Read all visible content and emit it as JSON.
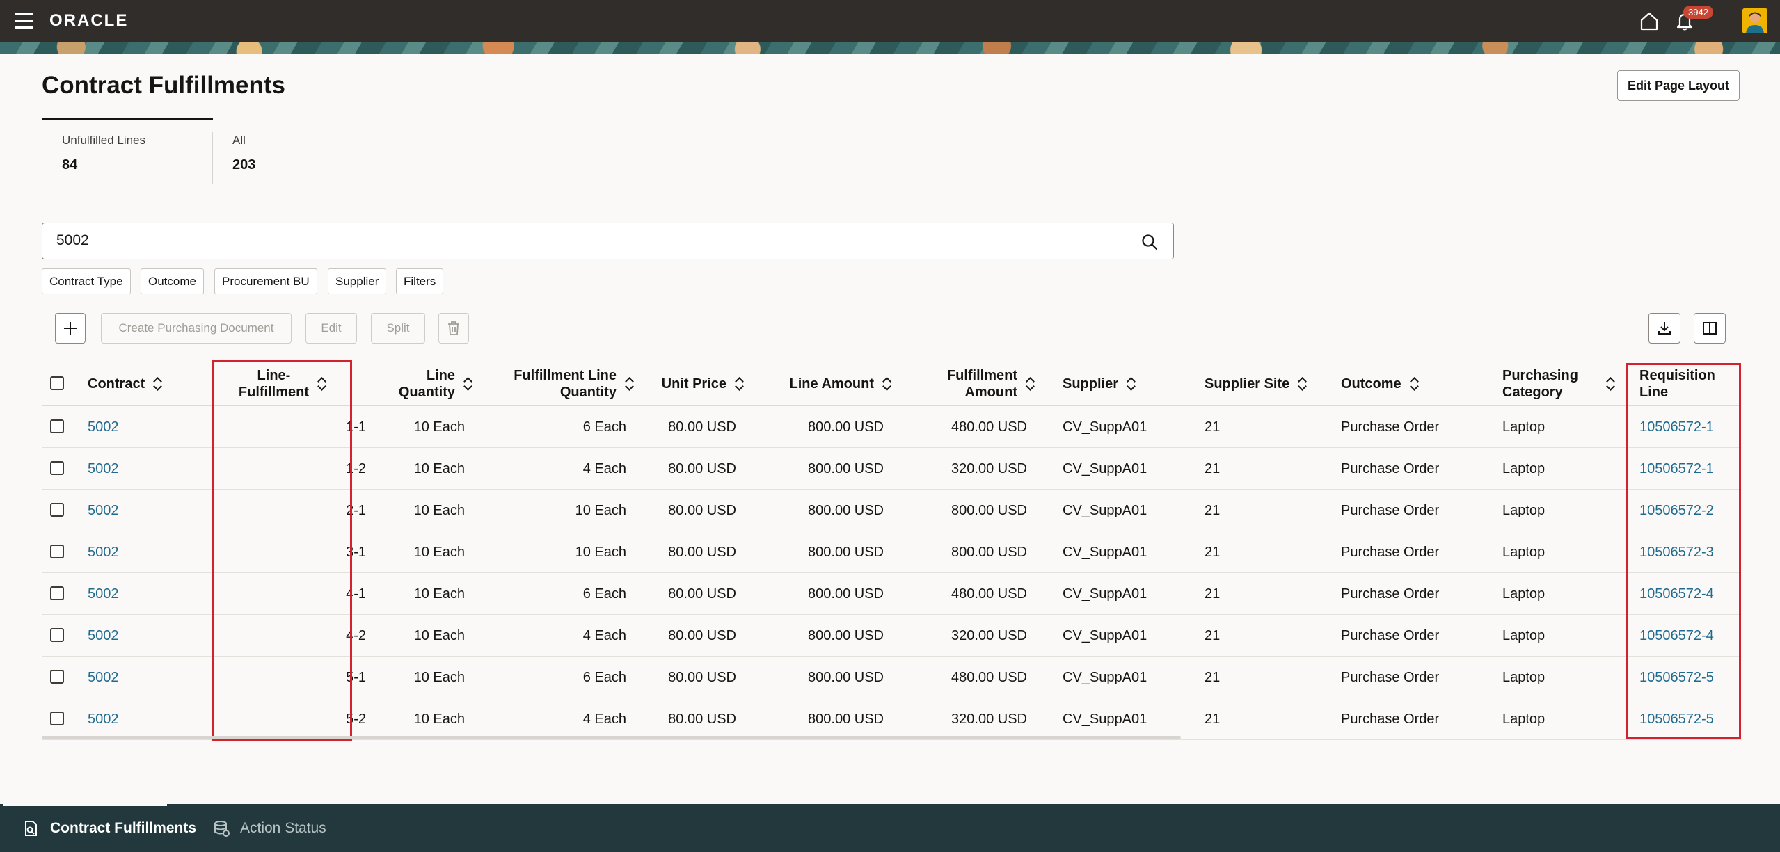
{
  "header": {
    "logo": "ORACLE",
    "notification_count": "3942"
  },
  "page": {
    "title": "Contract Fulfillments",
    "edit_layout_label": "Edit Page Layout"
  },
  "count_tabs": [
    {
      "label": "Unfulfilled Lines",
      "value": "84"
    },
    {
      "label": "All",
      "value": "203"
    }
  ],
  "search": {
    "value": "5002"
  },
  "filter_chips": [
    "Contract Type",
    "Outcome",
    "Procurement BU",
    "Supplier",
    "Filters"
  ],
  "toolbar": {
    "create_label": "Create Purchasing Document",
    "edit_label": "Edit",
    "split_label": "Split"
  },
  "table": {
    "headers": {
      "contract": "Contract",
      "line_fulfillment_1": "Line-",
      "line_fulfillment_2": "Fulfillment",
      "line_quantity_1": "Line",
      "line_quantity_2": "Quantity",
      "fulfillment_line_quantity_1": "Fulfillment Line",
      "fulfillment_line_quantity_2": "Quantity",
      "unit_price": "Unit Price",
      "line_amount": "Line Amount",
      "fulfillment_amount_1": "Fulfillment",
      "fulfillment_amount_2": "Amount",
      "supplier": "Supplier",
      "supplier_site": "Supplier Site",
      "outcome": "Outcome",
      "purchasing_category_1": "Purchasing",
      "purchasing_category_2": "Category",
      "requisition_line_1": "Requisition",
      "requisition_line_2": "Line"
    },
    "rows": [
      {
        "contract": "5002",
        "line_fulfillment": "1-1",
        "line_quantity": "10 Each",
        "fulfillment_line_quantity": "6 Each",
        "unit_price": "80.00 USD",
        "line_amount": "800.00 USD",
        "fulfillment_amount": "480.00 USD",
        "supplier": "CV_SuppA01",
        "supplier_site": "21",
        "outcome": "Purchase Order",
        "purchasing_category": "Laptop",
        "requisition_line": "10506572-1"
      },
      {
        "contract": "5002",
        "line_fulfillment": "1-2",
        "line_quantity": "10 Each",
        "fulfillment_line_quantity": "4 Each",
        "unit_price": "80.00 USD",
        "line_amount": "800.00 USD",
        "fulfillment_amount": "320.00 USD",
        "supplier": "CV_SuppA01",
        "supplier_site": "21",
        "outcome": "Purchase Order",
        "purchasing_category": "Laptop",
        "requisition_line": "10506572-1"
      },
      {
        "contract": "5002",
        "line_fulfillment": "2-1",
        "line_quantity": "10 Each",
        "fulfillment_line_quantity": "10 Each",
        "unit_price": "80.00 USD",
        "line_amount": "800.00 USD",
        "fulfillment_amount": "800.00 USD",
        "supplier": "CV_SuppA01",
        "supplier_site": "21",
        "outcome": "Purchase Order",
        "purchasing_category": "Laptop",
        "requisition_line": "10506572-2"
      },
      {
        "contract": "5002",
        "line_fulfillment": "3-1",
        "line_quantity": "10 Each",
        "fulfillment_line_quantity": "10 Each",
        "unit_price": "80.00 USD",
        "line_amount": "800.00 USD",
        "fulfillment_amount": "800.00 USD",
        "supplier": "CV_SuppA01",
        "supplier_site": "21",
        "outcome": "Purchase Order",
        "purchasing_category": "Laptop",
        "requisition_line": "10506572-3"
      },
      {
        "contract": "5002",
        "line_fulfillment": "4-1",
        "line_quantity": "10 Each",
        "fulfillment_line_quantity": "6 Each",
        "unit_price": "80.00 USD",
        "line_amount": "800.00 USD",
        "fulfillment_amount": "480.00 USD",
        "supplier": "CV_SuppA01",
        "supplier_site": "21",
        "outcome": "Purchase Order",
        "purchasing_category": "Laptop",
        "requisition_line": "10506572-4"
      },
      {
        "contract": "5002",
        "line_fulfillment": "4-2",
        "line_quantity": "10 Each",
        "fulfillment_line_quantity": "4 Each",
        "unit_price": "80.00 USD",
        "line_amount": "800.00 USD",
        "fulfillment_amount": "320.00 USD",
        "supplier": "CV_SuppA01",
        "supplier_site": "21",
        "outcome": "Purchase Order",
        "purchasing_category": "Laptop",
        "requisition_line": "10506572-4"
      },
      {
        "contract": "5002",
        "line_fulfillment": "5-1",
        "line_quantity": "10 Each",
        "fulfillment_line_quantity": "6 Each",
        "unit_price": "80.00 USD",
        "line_amount": "800.00 USD",
        "fulfillment_amount": "480.00 USD",
        "supplier": "CV_SuppA01",
        "supplier_site": "21",
        "outcome": "Purchase Order",
        "purchasing_category": "Laptop",
        "requisition_line": "10506572-5"
      },
      {
        "contract": "5002",
        "line_fulfillment": "5-2",
        "line_quantity": "10 Each",
        "fulfillment_line_quantity": "4 Each",
        "unit_price": "80.00 USD",
        "line_amount": "800.00 USD",
        "fulfillment_amount": "320.00 USD",
        "supplier": "CV_SuppA01",
        "supplier_site": "21",
        "outcome": "Purchase Order",
        "purchasing_category": "Laptop",
        "requisition_line": "10506572-5"
      }
    ]
  },
  "bottom_tabs": [
    {
      "label": "Contract Fulfillments",
      "icon": "document-search-icon"
    },
    {
      "label": "Action Status",
      "icon": "database-status-icon"
    }
  ],
  "colors": {
    "link": "#1e6b8f",
    "highlight": "#d0232e",
    "header_bg": "#312d2a",
    "bottom_bar_bg": "#22383c"
  }
}
